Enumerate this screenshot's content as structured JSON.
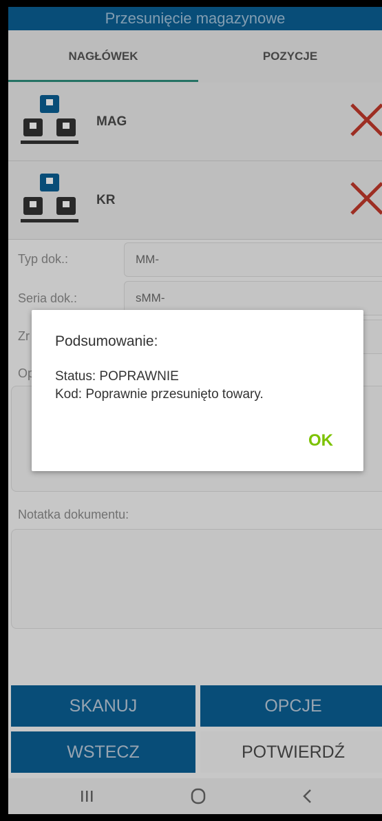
{
  "app": {
    "title": "Przesunięcie magazynowe"
  },
  "tabs": [
    {
      "label": "NAGŁÓWEK",
      "active": true
    },
    {
      "label": "POZYCJE",
      "active": false
    }
  ],
  "stores": [
    {
      "label": "MAG"
    },
    {
      "label": "KR"
    }
  ],
  "fields": {
    "typ_dok": {
      "label": "Typ dok.:",
      "value": "MM-"
    },
    "seria_dok": {
      "label": "Seria dok.:",
      "value": "sMM-"
    },
    "zr_label_partial": "Zr",
    "op_label_partial": "Op"
  },
  "notes": {
    "label": "Notatka dokumentu:"
  },
  "dialog": {
    "title": "Podsumowanie:",
    "status_line": "Status: POPRAWNIE",
    "code_line": "Kod: Poprawnie przesunięto towary.",
    "ok_label": "OK"
  },
  "buttons": {
    "skanuj": "SKANUJ",
    "opcje": "OPCJE",
    "wstecz": "WSTECZ",
    "potwierdz": "POTWIERDŹ"
  },
  "colors": {
    "primary": "#0a5e93",
    "accent_ok": "#7cc200",
    "remove": "#c0392b"
  }
}
